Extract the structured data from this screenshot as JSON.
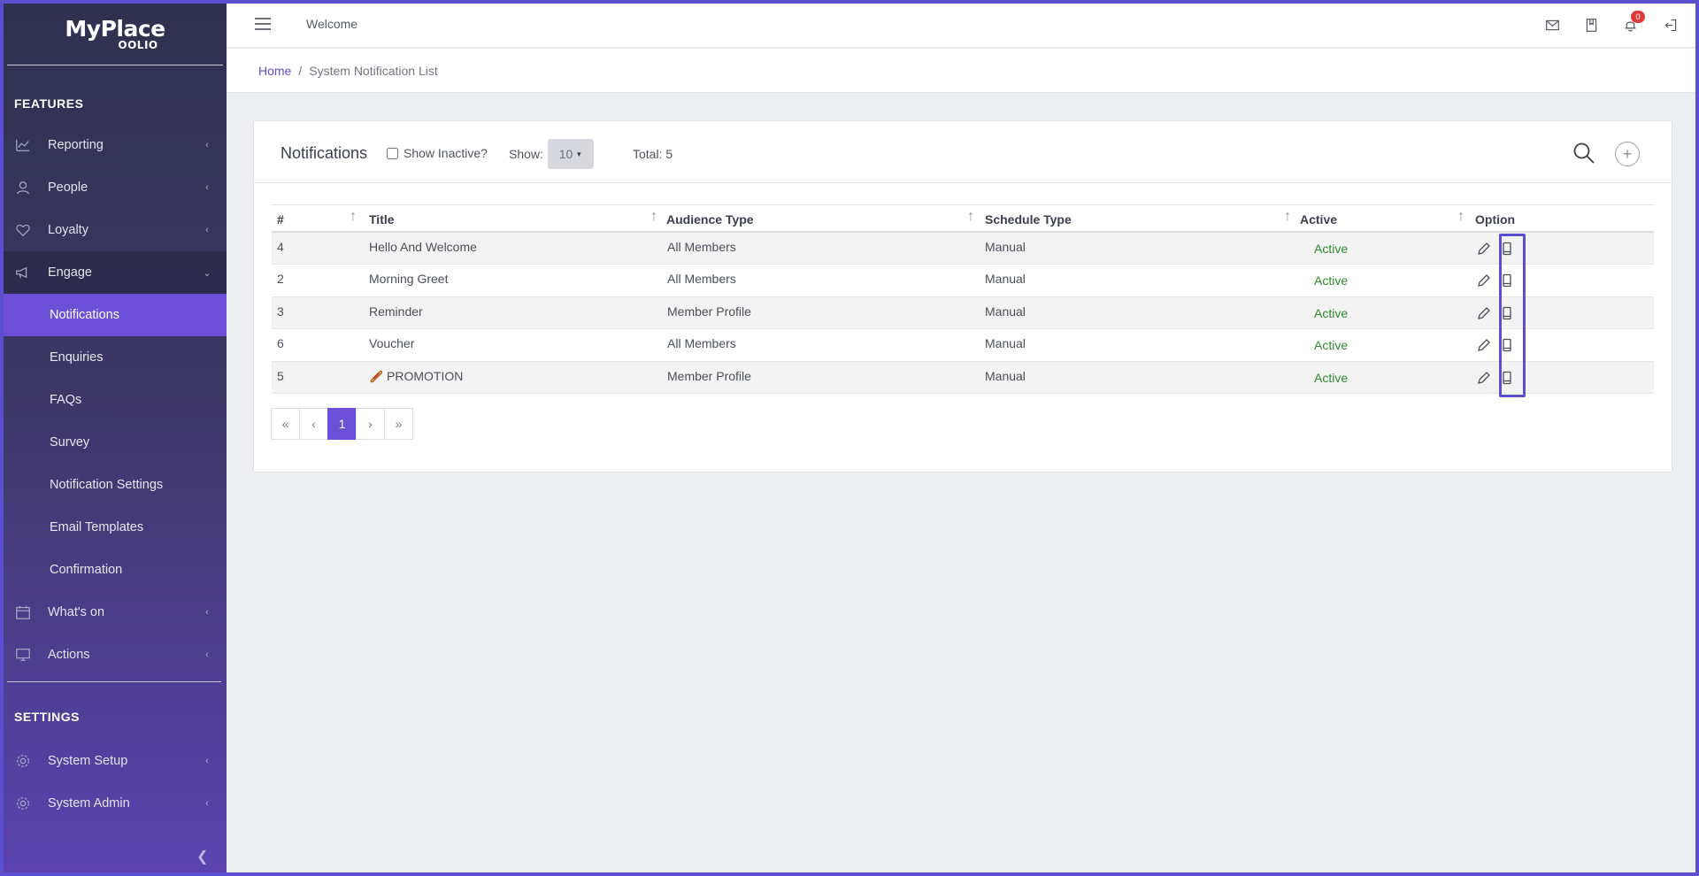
{
  "brand": {
    "name": "MyPlace",
    "sub": "OOLIO"
  },
  "sidebar": {
    "features_title": "FEATURES",
    "settings_title": "SETTINGS",
    "items": [
      {
        "label": "Reporting",
        "icon": "chart-icon"
      },
      {
        "label": "People",
        "icon": "person-icon"
      },
      {
        "label": "Loyalty",
        "icon": "heart-icon"
      },
      {
        "label": "Engage",
        "icon": "megaphone-icon"
      }
    ],
    "engage_subitems": [
      {
        "label": "Notifications"
      },
      {
        "label": "Enquiries"
      },
      {
        "label": "FAQs"
      },
      {
        "label": "Survey"
      },
      {
        "label": "Notification Settings"
      },
      {
        "label": "Email Templates"
      },
      {
        "label": "Confirmation"
      }
    ],
    "whats_on": "What's on",
    "actions": "Actions",
    "system_setup": "System Setup",
    "system_admin": "System Admin"
  },
  "topbar": {
    "welcome": "Welcome",
    "notification_count": "0"
  },
  "breadcrumb": {
    "home": "Home",
    "current": "System Notification List"
  },
  "card": {
    "title": "Notifications",
    "show_inactive": "Show Inactive?",
    "show_label": "Show:",
    "show_value": "10",
    "total": "Total: 5"
  },
  "table": {
    "headers": [
      "#",
      "Title",
      "Audience Type",
      "Schedule Type",
      "Active",
      "Option"
    ],
    "rows": [
      {
        "id": "4",
        "title": "Hello And Welcome",
        "audience": "All Members",
        "schedule": "Manual",
        "active": "Active"
      },
      {
        "id": "2",
        "title": "Morning Greet",
        "audience": "All Members",
        "schedule": "Manual",
        "active": "Active"
      },
      {
        "id": "3",
        "title": "Reminder",
        "audience": "Member Profile",
        "schedule": "Manual",
        "active": "Active"
      },
      {
        "id": "6",
        "title": "Voucher",
        "audience": "All Members",
        "schedule": "Manual",
        "active": "Active"
      },
      {
        "id": "5",
        "title": "PROMOTION",
        "audience": "Member Profile",
        "schedule": "Manual",
        "active": "Active"
      }
    ]
  },
  "pagination": {
    "first": "«",
    "prev": "‹",
    "current": "1",
    "next": "›",
    "last": "»"
  },
  "colors": {
    "accent": "#6b4fd6",
    "active_text": "#2e8b2e",
    "badge": "#e03b3b"
  }
}
